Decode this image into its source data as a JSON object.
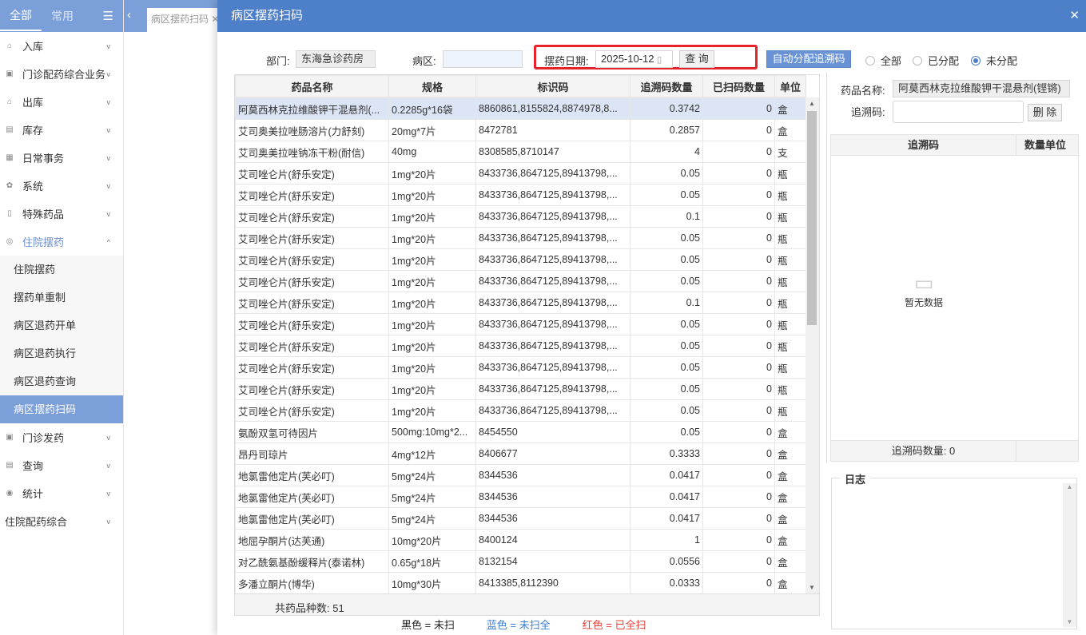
{
  "sidebar": {
    "tabs": [
      "全部",
      "常用"
    ],
    "items": [
      {
        "label": "入库",
        "icon": "inbound-icon"
      },
      {
        "label": "门诊配药综合业务",
        "icon": "clinic-icon"
      },
      {
        "label": "出库",
        "icon": "outbound-icon"
      },
      {
        "label": "库存",
        "icon": "stock-icon"
      },
      {
        "label": "日常事务",
        "icon": "calendar-icon"
      },
      {
        "label": "系统",
        "icon": "gear-icon"
      },
      {
        "label": "特殊药品",
        "icon": "bottle-icon"
      },
      {
        "label": "住院摆药",
        "icon": "target-icon"
      }
    ],
    "subitems": [
      "住院摆药",
      "摆药单重制",
      "病区退药开单",
      "病区退药执行",
      "病区退药查询",
      "病区摆药扫码"
    ],
    "items_after": [
      {
        "label": "门诊发药",
        "icon": "pharmacy-icon"
      },
      {
        "label": "查询",
        "icon": "query-icon"
      },
      {
        "label": "统计",
        "icon": "chart-icon"
      },
      {
        "label": "住院配药综合",
        "icon": ""
      }
    ]
  },
  "tabbar": {
    "tab": "病区摆药扫码"
  },
  "modal": {
    "title": "病区摆药扫码",
    "dept_label": "部门:",
    "dept_value": "东海急诊药房",
    "ward_label": "病区:",
    "ward_value": "",
    "date_label": "摆药日期:",
    "date_value": "2025-10-12",
    "query_button": "查 询",
    "auto_button": "自动分配追溯码",
    "radios": [
      {
        "label": "全部",
        "checked": false
      },
      {
        "label": "已分配",
        "checked": false
      },
      {
        "label": "未分配",
        "checked": true
      }
    ],
    "columns": [
      "药品名称",
      "规格",
      "标识码",
      "追溯码数量",
      "已扫码数量",
      "单位"
    ],
    "rows": [
      [
        "阿莫西林克拉维酸钾干混悬剂(...",
        "0.2285g*16袋",
        "8860861,8155824,8874978,8...",
        "0.3742",
        "0",
        "盒"
      ],
      [
        "艾司奥美拉唑肠溶片(力舒刻)",
        "20mg*7片",
        "8472781",
        "0.2857",
        "0",
        "盒"
      ],
      [
        "艾司奥美拉唑钠冻干粉(耐信)",
        "40mg",
        "8308585,8710147",
        "4",
        "0",
        "支"
      ],
      [
        "艾司唑仑片(舒乐安定)",
        "1mg*20片",
        "8433736,8647125,89413798,...",
        "0.05",
        "0",
        "瓶"
      ],
      [
        "艾司唑仑片(舒乐安定)",
        "1mg*20片",
        "8433736,8647125,89413798,...",
        "0.05",
        "0",
        "瓶"
      ],
      [
        "艾司唑仑片(舒乐安定)",
        "1mg*20片",
        "8433736,8647125,89413798,...",
        "0.1",
        "0",
        "瓶"
      ],
      [
        "艾司唑仑片(舒乐安定)",
        "1mg*20片",
        "8433736,8647125,89413798,...",
        "0.05",
        "0",
        "瓶"
      ],
      [
        "艾司唑仑片(舒乐安定)",
        "1mg*20片",
        "8433736,8647125,89413798,...",
        "0.05",
        "0",
        "瓶"
      ],
      [
        "艾司唑仑片(舒乐安定)",
        "1mg*20片",
        "8433736,8647125,89413798,...",
        "0.05",
        "0",
        "瓶"
      ],
      [
        "艾司唑仑片(舒乐安定)",
        "1mg*20片",
        "8433736,8647125,89413798,...",
        "0.1",
        "0",
        "瓶"
      ],
      [
        "艾司唑仑片(舒乐安定)",
        "1mg*20片",
        "8433736,8647125,89413798,...",
        "0.05",
        "0",
        "瓶"
      ],
      [
        "艾司唑仑片(舒乐安定)",
        "1mg*20片",
        "8433736,8647125,89413798,...",
        "0.05",
        "0",
        "瓶"
      ],
      [
        "艾司唑仑片(舒乐安定)",
        "1mg*20片",
        "8433736,8647125,89413798,...",
        "0.05",
        "0",
        "瓶"
      ],
      [
        "艾司唑仑片(舒乐安定)",
        "1mg*20片",
        "8433736,8647125,89413798,...",
        "0.05",
        "0",
        "瓶"
      ],
      [
        "艾司唑仑片(舒乐安定)",
        "1mg*20片",
        "8433736,8647125,89413798,...",
        "0.05",
        "0",
        "瓶"
      ],
      [
        "氨酚双氢可待因片",
        "500mg:10mg*2...",
        "8454550",
        "0.05",
        "0",
        "盒"
      ],
      [
        "昂丹司琼片",
        "4mg*12片",
        "8406677",
        "0.3333",
        "0",
        "盒"
      ],
      [
        "地氯雷他定片(芙必叮)",
        "5mg*24片",
        "8344536",
        "0.0417",
        "0",
        "盒"
      ],
      [
        "地氯雷他定片(芙必叮)",
        "5mg*24片",
        "8344536",
        "0.0417",
        "0",
        "盒"
      ],
      [
        "地氯雷他定片(芙必叮)",
        "5mg*24片",
        "8344536",
        "0.0417",
        "0",
        "盒"
      ],
      [
        "地屈孕酮片(达芙通)",
        "10mg*20片",
        "8400124",
        "1",
        "0",
        "盒"
      ],
      [
        "对乙酰氨基酚缓释片(泰诺林)",
        "0.65g*18片",
        "8132154",
        "0.0556",
        "0",
        "盒"
      ],
      [
        "多潘立酮片(博华)",
        "10mg*30片",
        "8413385,8112390",
        "0.0333",
        "0",
        "盒"
      ]
    ],
    "footer": "共药品种数: 51",
    "legend": [
      {
        "text": "黑色 = 未扫",
        "color": "#222222"
      },
      {
        "text": "蓝色 = 未扫全",
        "color": "#3d7fd6"
      },
      {
        "text": "红色 = 已全扫",
        "color": "#e8413a"
      }
    ],
    "right": {
      "drug_label": "药品名称:",
      "drug_value": "阿莫西林克拉维酸钾干混悬剂(铿锵)",
      "trace_label": "追溯码:",
      "trace_value": "",
      "delete_button": "删 除",
      "columns": [
        "追溯码",
        "数量单位"
      ],
      "empty": "暂无数据",
      "count": "追溯码数量: 0",
      "log_title": "日志"
    }
  },
  "colors": {
    "accent": "#4e7fc9",
    "sidebar": "#7b9fd8",
    "highlight": "#e8222a"
  }
}
